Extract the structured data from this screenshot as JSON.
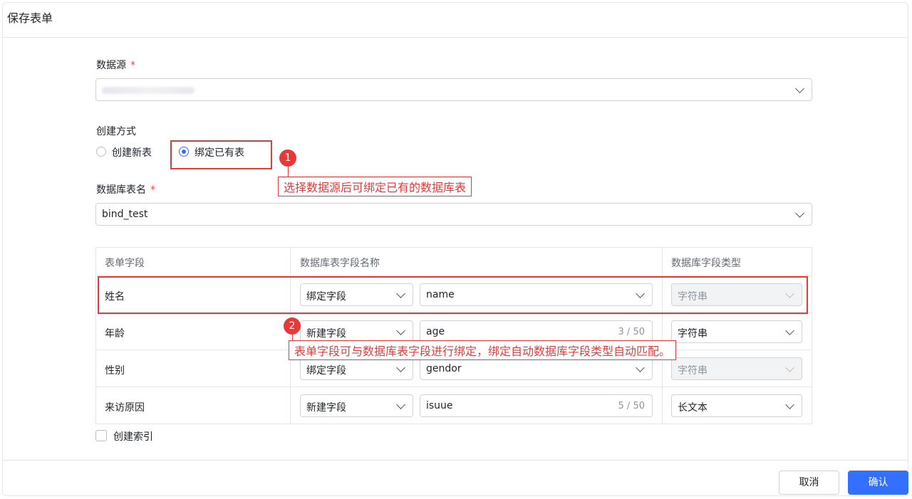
{
  "dialog": {
    "title": "保存表单"
  },
  "datasource": {
    "label": "数据源",
    "required_mark": "*"
  },
  "create_mode": {
    "label": "创建方式",
    "options": [
      {
        "label": "创建新表",
        "selected": false
      },
      {
        "label": "绑定已有表",
        "selected": true
      }
    ]
  },
  "db_table": {
    "label": "数据库表名",
    "required_mark": "*",
    "value": "bind_test"
  },
  "table": {
    "headers": [
      "表单字段",
      "数据库表字段名称",
      "数据库字段类型"
    ],
    "rows": [
      {
        "field": "姓名",
        "mode": "绑定字段",
        "column": "name",
        "count": "",
        "type": "字符串",
        "type_disabled": true
      },
      {
        "field": "年龄",
        "mode": "新建字段",
        "column": "age",
        "count": "3 / 50",
        "type": "字符串",
        "type_disabled": false
      },
      {
        "field": "性别",
        "mode": "绑定字段",
        "column": "gendor",
        "count": "",
        "type": "字符串",
        "type_disabled": true
      },
      {
        "field": "来访原因",
        "mode": "新建字段",
        "column": "isuue",
        "count": "5 / 50",
        "type": "长文本",
        "type_disabled": false
      }
    ]
  },
  "index": {
    "label": "创建索引"
  },
  "annotations": [
    {
      "number": "1",
      "text": "选择数据源后可绑定已有的数据库表"
    },
    {
      "number": "2",
      "text": "表单字段可与数据库表字段进行绑定，绑定自动数据库字段类型自动匹配。"
    }
  ],
  "footer": {
    "cancel": "取消",
    "confirm": "确认"
  },
  "colors": {
    "primary": "#3370ff",
    "annotation": "#e8393a",
    "border": "#d0d3d6"
  }
}
